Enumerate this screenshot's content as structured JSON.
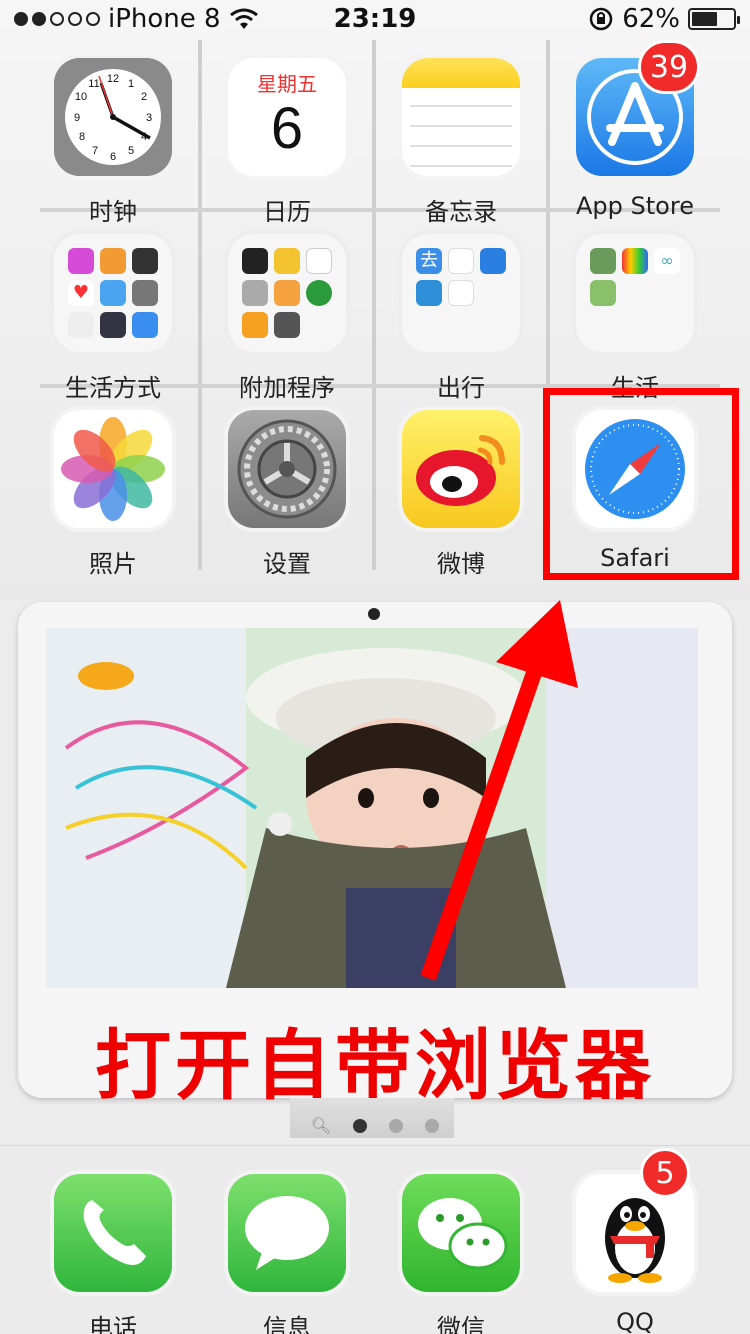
{
  "status_bar": {
    "carrier": "iPhone 8",
    "time": "23:19",
    "battery": "62%",
    "battery_level": 0.62,
    "signal_bars_filled": 2,
    "signal_bars_total": 5
  },
  "apps": {
    "clock": {
      "label": "时钟",
      "icon": "clock-icon"
    },
    "calendar": {
      "label": "日历",
      "weekday": "星期五",
      "day": "6",
      "icon": "calendar-icon"
    },
    "notes": {
      "label": "备忘录",
      "icon": "notes-icon"
    },
    "appstore": {
      "label": "App Store",
      "badge": "39",
      "icon": "appstore-icon"
    },
    "lifestyle_folder": {
      "label": "生活方式",
      "icon": "folder-icon"
    },
    "extras_folder": {
      "label": "附加程序",
      "icon": "folder-icon"
    },
    "travel_folder": {
      "label": "出行",
      "icon": "folder-icon"
    },
    "life_folder": {
      "label": "生活",
      "icon": "folder-icon"
    },
    "photos": {
      "label": "照片",
      "icon": "photos-icon"
    },
    "settings": {
      "label": "设置",
      "icon": "gear-icon"
    },
    "weibo": {
      "label": "微博",
      "icon": "weibo-icon"
    },
    "safari": {
      "label": "Safari",
      "icon": "compass-icon"
    }
  },
  "dock": {
    "phone": {
      "label": "电话",
      "icon": "phone-icon"
    },
    "messages": {
      "label": "信息",
      "icon": "message-icon"
    },
    "wechat": {
      "label": "微信",
      "icon": "wechat-icon"
    },
    "qq": {
      "label": "QQ",
      "badge": "5",
      "icon": "penguin-icon"
    }
  },
  "annotation": {
    "caption": "打开自带浏览器",
    "highlight_color": "#ff0000"
  },
  "page_indicator": {
    "pages": 3,
    "current": 1
  }
}
